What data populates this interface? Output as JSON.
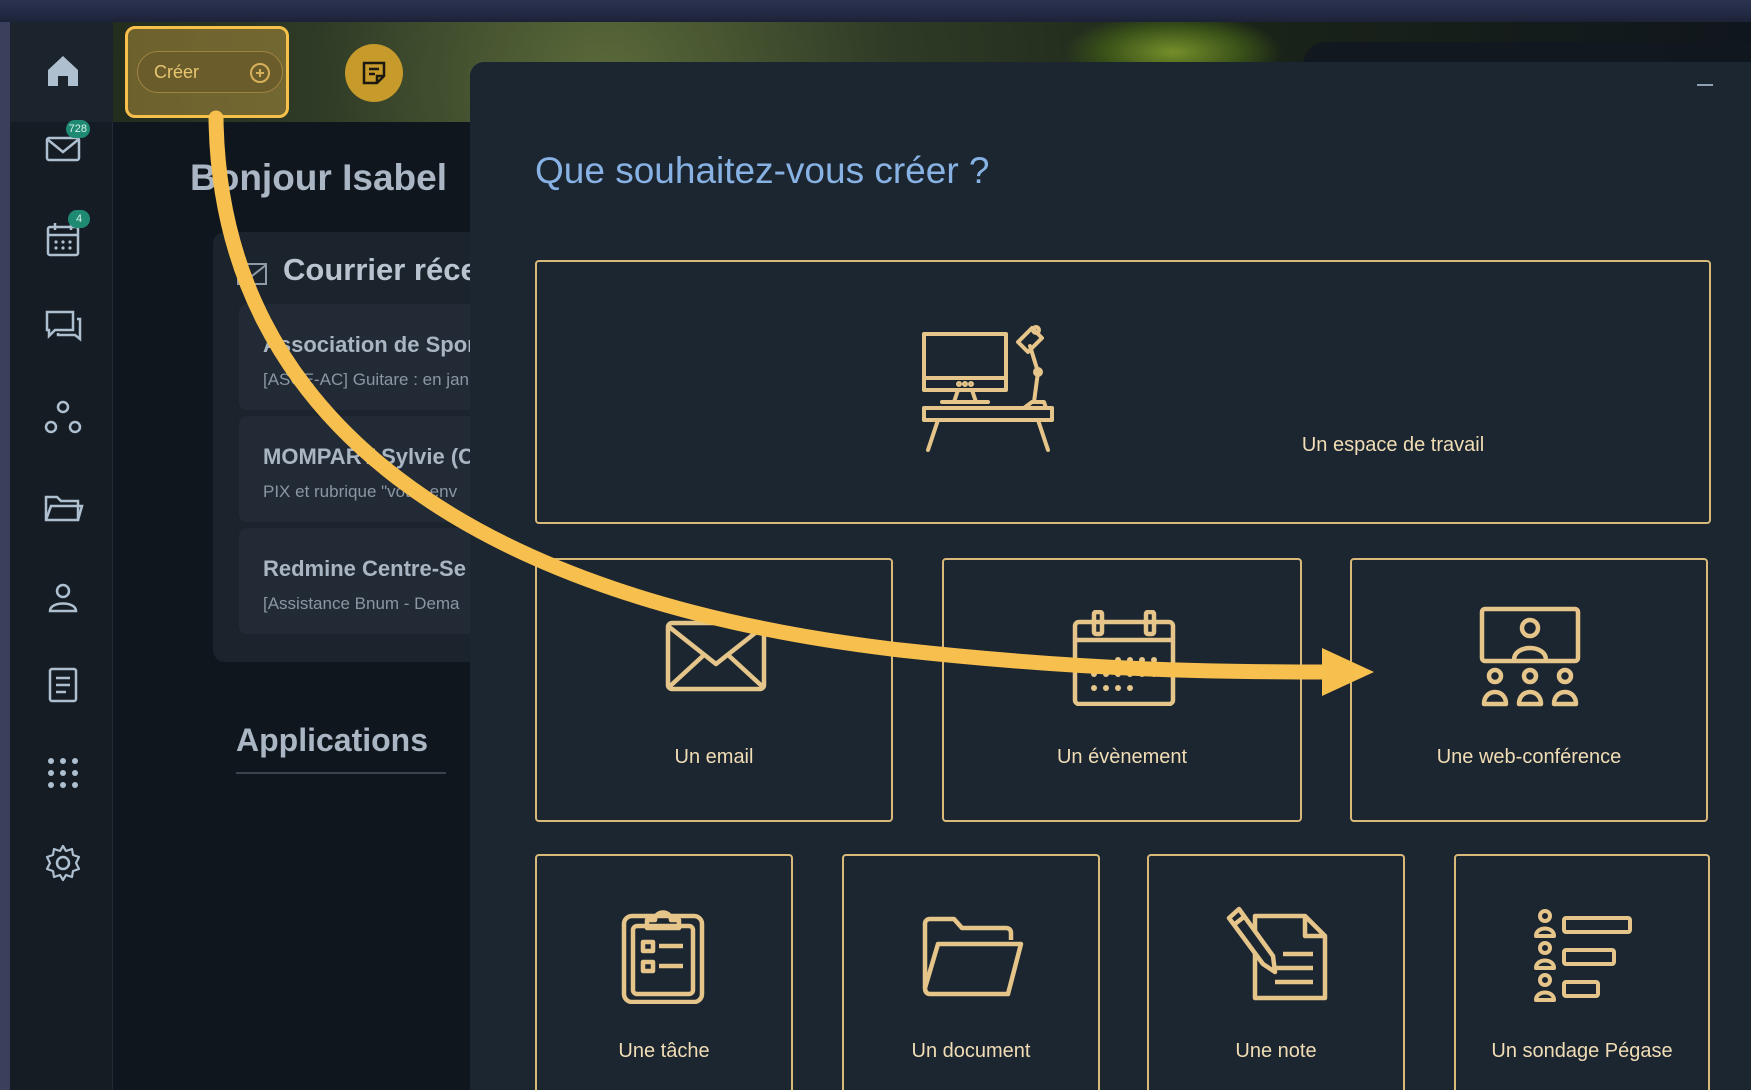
{
  "sidebar": {
    "mail_badge": "728",
    "calendar_badge": "4"
  },
  "header": {
    "create_label": "Créer"
  },
  "main": {
    "greeting": "Bonjour Isabel",
    "mail_card_title": "Courrier réce",
    "mail_items": [
      {
        "from": "Association de Spor",
        "subject": "[ASCE-AC] Guitare : en jan"
      },
      {
        "from": "MOMPART Sylvie (C",
        "subject": "PIX et rubrique \"votre env"
      },
      {
        "from": "Redmine Centre-Se",
        "subject": "[Assistance Bnum - Dema"
      }
    ],
    "apps_title": "Applications"
  },
  "modal": {
    "title": "Que souhaitez-vous créer ?",
    "options": {
      "workspace": "Un espace de travail",
      "email": "Un email",
      "event": "Un évènement",
      "webconf": "Une web-conférence",
      "task": "Une tâche",
      "document": "Un document",
      "note": "Une note",
      "survey": "Un sondage Pégase"
    }
  },
  "colors": {
    "accent_gold": "#f7c04a",
    "tile_border": "#d9b97a",
    "title_blue": "#87b2e3",
    "badge_green": "#1f8a72"
  }
}
